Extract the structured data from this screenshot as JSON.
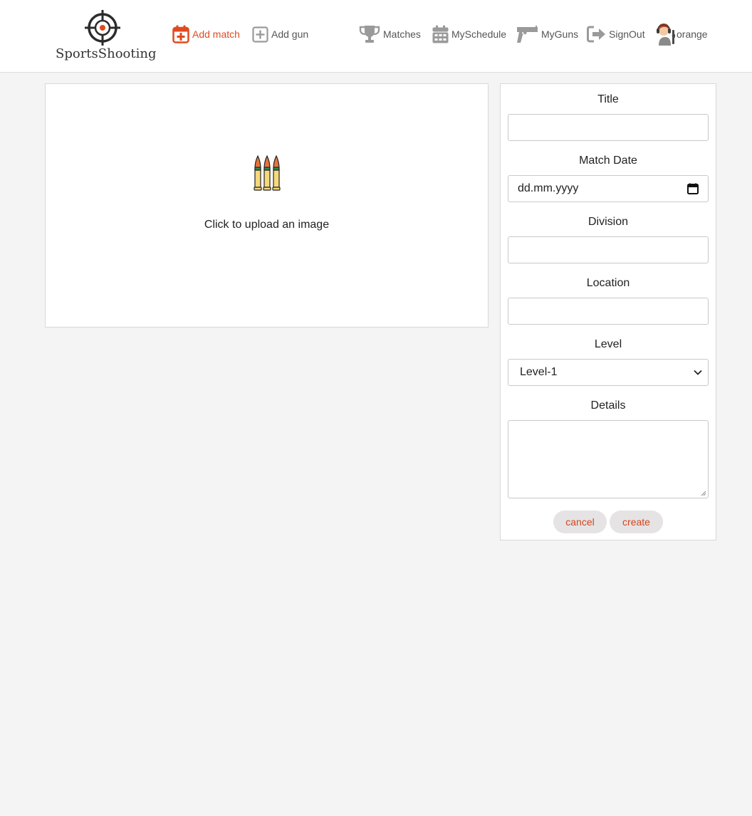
{
  "header": {
    "logo_text": "SportsShooting",
    "nav": {
      "add_match": "Add match",
      "add_gun": "Add gun",
      "matches": "Matches",
      "my_schedule": "MySchedule",
      "my_guns": "MyGuns",
      "sign_out": "SignOut",
      "username": "orange"
    },
    "accent_color": "#e04a1f",
    "icon_color": "#9a9a9a"
  },
  "upload": {
    "text": "Click to upload an image",
    "icon": "bullets-icon"
  },
  "form": {
    "title_label": "Title",
    "title_value": "",
    "date_label": "Match Date",
    "date_placeholder": "dd.mm.yyyy",
    "division_label": "Division",
    "division_value": "",
    "location_label": "Location",
    "location_value": "",
    "level_label": "Level",
    "level_selected": "Level-1",
    "details_label": "Details",
    "details_value": "",
    "cancel_label": "cancel",
    "create_label": "create"
  }
}
